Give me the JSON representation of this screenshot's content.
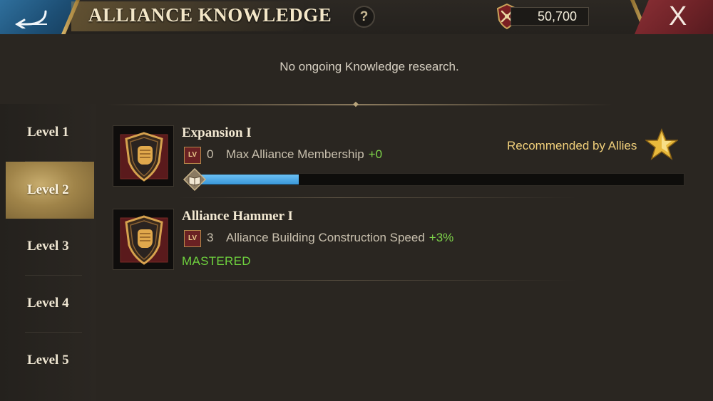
{
  "header": {
    "title": "ALLIANCE KNOWLEDGE",
    "help_label": "?",
    "currency_value": "50,700",
    "close_label": "X"
  },
  "status": {
    "text": "No ongoing Knowledge research."
  },
  "sidebar": {
    "items": [
      {
        "label": "Level 1",
        "active": false
      },
      {
        "label": "Level 2",
        "active": true
      },
      {
        "label": "Level 3",
        "active": false
      },
      {
        "label": "Level 4",
        "active": false
      },
      {
        "label": "Level 5",
        "active": false
      }
    ]
  },
  "knowledge": [
    {
      "name": "Expansion I",
      "level_badge": "LV",
      "level": "0",
      "effect": "Max Alliance Membership",
      "bonus": "+0",
      "recommended_label": "Recommended by Allies",
      "progress_fraction": 0.21
    },
    {
      "name": "Alliance Hammer I",
      "level_badge": "LV",
      "level": "3",
      "effect": "Alliance Building Construction Speed",
      "bonus": "+3%",
      "state_label": "MASTERED"
    }
  ],
  "colors": {
    "accent_gold": "#f0cf7a",
    "bonus_green": "#7ed44a",
    "progress_blue": "#3996d8",
    "back_blue": "#2f6f9c",
    "close_red": "#8a2f35"
  },
  "icons": {
    "back": "back-arrow-icon",
    "currency": "alliance-crest-icon",
    "card": "shield-fist-icon",
    "book": "book-icon",
    "star": "star-icon"
  }
}
